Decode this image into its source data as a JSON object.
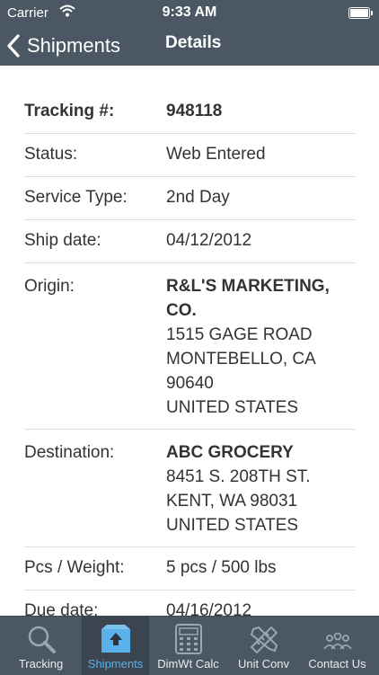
{
  "status_bar": {
    "carrier": "Carrier",
    "time": "9:33 AM"
  },
  "nav": {
    "back_label": "Shipments",
    "title": "Details"
  },
  "details": {
    "tracking": {
      "label": "Tracking #:",
      "value": "948118"
    },
    "status": {
      "label": "Status:",
      "value": "Web Entered"
    },
    "service_type": {
      "label": "Service Type:",
      "value": "2nd Day"
    },
    "ship_date": {
      "label": "Ship date:",
      "value": "04/12/2012"
    },
    "origin": {
      "label": "Origin:",
      "name_line1": "R&L'S MARKETING,",
      "name_line2": "CO.",
      "address1": "1515 GAGE ROAD",
      "address2": "MONTEBELLO, CA",
      "address3": "90640",
      "country": "UNITED STATES"
    },
    "destination": {
      "label": "Destination:",
      "name": "ABC GROCERY",
      "address1": "8451 S. 208TH ST.",
      "address2": "KENT, WA 98031",
      "country": "UNITED STATES"
    },
    "pcs_weight": {
      "label": "Pcs / Weight:",
      "value": "5 pcs / 500 lbs"
    },
    "due_date": {
      "label": "Due date:",
      "value": "04/16/2012"
    }
  },
  "tabs": [
    {
      "label": "Tracking",
      "icon": "magnifier-icon"
    },
    {
      "label": "Shipments",
      "icon": "package-icon",
      "active": true
    },
    {
      "label": "DimWt Calc",
      "icon": "calculator-icon"
    },
    {
      "label": "Unit Conv",
      "icon": "ruler-pencil-icon"
    },
    {
      "label": "Contact Us",
      "icon": "people-icon"
    }
  ],
  "colors": {
    "bar": "#4b5863",
    "active_tab": "#5ab0e8",
    "divider": "#dddddd"
  }
}
